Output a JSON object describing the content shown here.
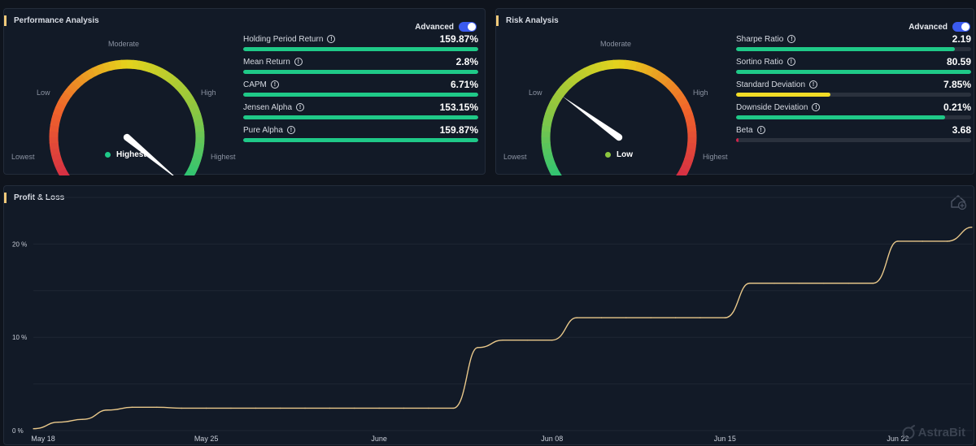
{
  "performance": {
    "title": "Performance Analysis",
    "advanced_label": "Advanced",
    "gauge": {
      "labels": {
        "lowest": "Lowest",
        "low": "Low",
        "moderate": "Moderate",
        "high": "High",
        "highest": "Highest"
      },
      "status": "Highest",
      "status_color": "#1fc988",
      "level": 0.98
    },
    "metrics": [
      {
        "label": "Holding Period Return",
        "value": "159.87%",
        "fill": 1.0,
        "color": "#1fc988"
      },
      {
        "label": "Mean Return",
        "value": "2.8%",
        "fill": 1.0,
        "color": "#1fc988"
      },
      {
        "label": "CAPM",
        "value": "6.71%",
        "fill": 1.0,
        "color": "#1fc988"
      },
      {
        "label": "Jensen Alpha",
        "value": "153.15%",
        "fill": 1.0,
        "color": "#1fc988"
      },
      {
        "label": "Pure Alpha",
        "value": "159.87%",
        "fill": 1.0,
        "color": "#1fc988"
      }
    ]
  },
  "risk": {
    "title": "Risk Analysis",
    "advanced_label": "Advanced",
    "gauge": {
      "labels": {
        "lowest": "Lowest",
        "low": "Low",
        "moderate": "Moderate",
        "high": "High",
        "highest": "Highest"
      },
      "status": "Low",
      "status_color": "#8cc63f",
      "level": 0.3
    },
    "metrics": [
      {
        "label": "Sharpe Ratio",
        "value": "2.19",
        "fill": 0.93,
        "color": "#1fc988"
      },
      {
        "label": "Sortino Ratio",
        "value": "80.59",
        "fill": 1.0,
        "color": "#1fc988"
      },
      {
        "label": "Standard Deviation",
        "value": "7.85%",
        "fill": 0.4,
        "color": "#f2dc26"
      },
      {
        "label": "Downside Deviation",
        "value": "0.21%",
        "fill": 0.89,
        "color": "#1fc988"
      },
      {
        "label": "Beta",
        "value": "3.68",
        "fill": 0.005,
        "color": "#d0234a"
      }
    ]
  },
  "pnl": {
    "title": "Profit & Loss",
    "watermark": "AstraBit",
    "line_color": "#e9c88a",
    "chart_data": {
      "type": "line",
      "title": "Profit & Loss",
      "xlabel": "",
      "ylabel": "",
      "x_tick_labels": [
        "May 18",
        "May 25",
        "June",
        "Jun 08",
        "Jun 15",
        "Jun 22"
      ],
      "y_tick_labels": [
        "0 %",
        "10 %",
        "20 %"
      ],
      "ylim": [
        0,
        25
      ],
      "series": [
        {
          "x": [
            "2024-05-18",
            "2024-05-19",
            "2024-05-20",
            "2024-05-21",
            "2024-05-22",
            "2024-05-23",
            "2024-05-24",
            "2024-05-25",
            "2024-05-26",
            "2024-05-27",
            "2024-05-28",
            "2024-05-29",
            "2024-05-30",
            "2024-05-31",
            "2024-06-01",
            "2024-06-02",
            "2024-06-03",
            "2024-06-04",
            "2024-06-05",
            "2024-06-06",
            "2024-06-07",
            "2024-06-08",
            "2024-06-09",
            "2024-06-10",
            "2024-06-11",
            "2024-06-12",
            "2024-06-13",
            "2024-06-14",
            "2024-06-15",
            "2024-06-16",
            "2024-06-17",
            "2024-06-18",
            "2024-06-19",
            "2024-06-20",
            "2024-06-21",
            "2024-06-22",
            "2024-06-23",
            "2024-06-24",
            "2024-06-25"
          ],
          "values": [
            0.2,
            0.9,
            1.2,
            2.2,
            2.5,
            2.5,
            2.4,
            2.4,
            2.4,
            2.4,
            2.4,
            2.4,
            2.4,
            2.4,
            2.4,
            2.4,
            2.4,
            2.4,
            8.9,
            9.7,
            9.7,
            9.7,
            12.1,
            12.1,
            12.1,
            12.1,
            12.1,
            12.1,
            12.1,
            15.8,
            15.8,
            15.8,
            15.8,
            15.8,
            15.8,
            20.3,
            20.3,
            20.3,
            21.8
          ]
        }
      ]
    }
  }
}
